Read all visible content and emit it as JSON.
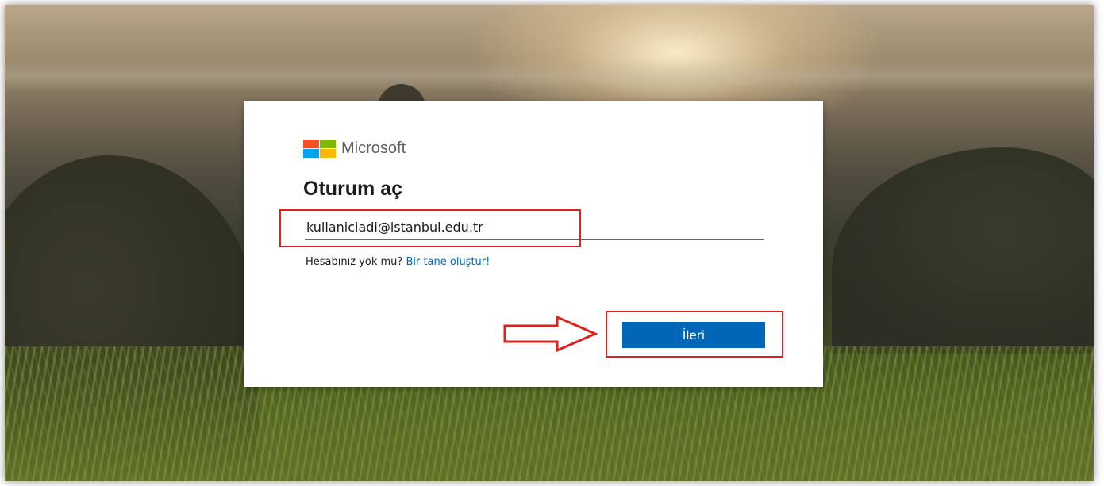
{
  "brand": {
    "name": "Microsoft"
  },
  "signin": {
    "title": "Oturum aç",
    "email_value": "kullaniciadi@istanbul.edu.tr",
    "no_account_text": "Hesabınız yok mu?",
    "create_link": "Bir tane oluştur!",
    "next_label": "İleri"
  },
  "colors": {
    "accent": "#0067b8",
    "annotation_red": "#e0201c",
    "logo": [
      "#f25022",
      "#7fba00",
      "#00a4ef",
      "#ffb900"
    ]
  },
  "icons": {
    "annotation_arrow": "right-arrow-icon"
  }
}
